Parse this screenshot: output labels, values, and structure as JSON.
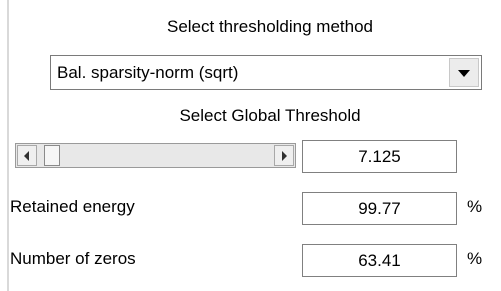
{
  "panel": {
    "method_heading": "Select thresholding method",
    "method_dropdown": {
      "selected": "Bal. sparsity-norm (sqrt)"
    },
    "threshold_heading": "Select Global Threshold",
    "threshold_slider": {
      "position_fraction": 0.03
    },
    "threshold_value": "7.125",
    "retained_energy": {
      "label": "Retained energy",
      "value": "99.77",
      "unit": "%"
    },
    "number_of_zeros": {
      "label": "Number of zeros",
      "value": "63.41",
      "unit": "%"
    }
  },
  "icons": {
    "dropdown_arrow": "chevron-down-icon",
    "slider_left": "arrow-left-icon",
    "slider_right": "arrow-right-icon"
  }
}
